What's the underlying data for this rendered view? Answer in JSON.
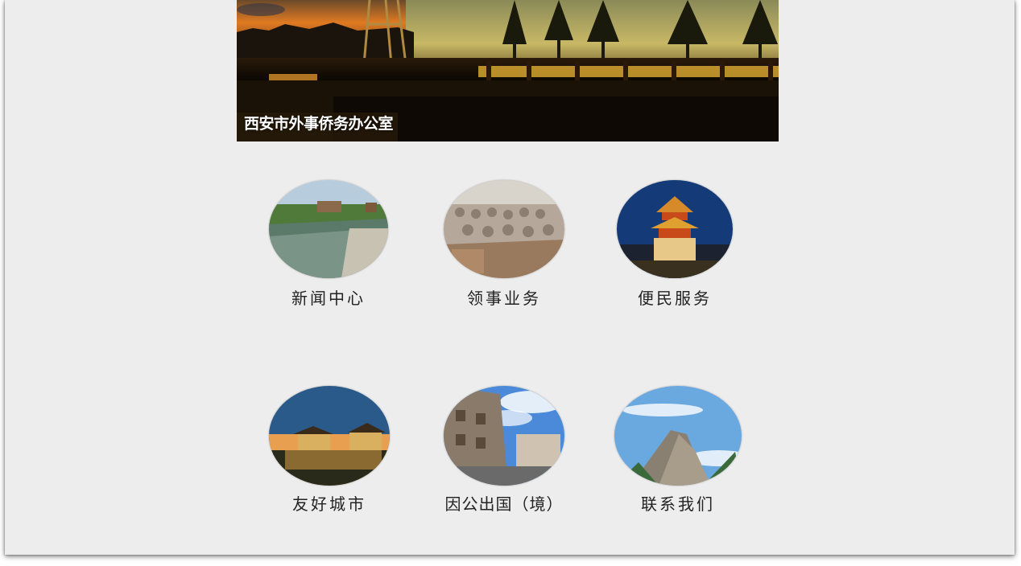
{
  "banner": {
    "title": "西安市外事侨务办公室"
  },
  "tiles": [
    {
      "label": "新闻中心",
      "image": "city-moat-photo"
    },
    {
      "label": "领事业务",
      "image": "terracotta-warriors-photo"
    },
    {
      "label": "便民服务",
      "image": "bell-tower-photo"
    },
    {
      "label": "友好城市",
      "image": "city-wall-gate-photo"
    },
    {
      "label": "因公出国（境）",
      "image": "cave-temple-photo"
    },
    {
      "label": "联系我们",
      "image": "huashan-mountain-photo"
    }
  ],
  "colors": {
    "background": "#ededed",
    "label_text": "#222222",
    "banner_text": "#ffffff"
  }
}
